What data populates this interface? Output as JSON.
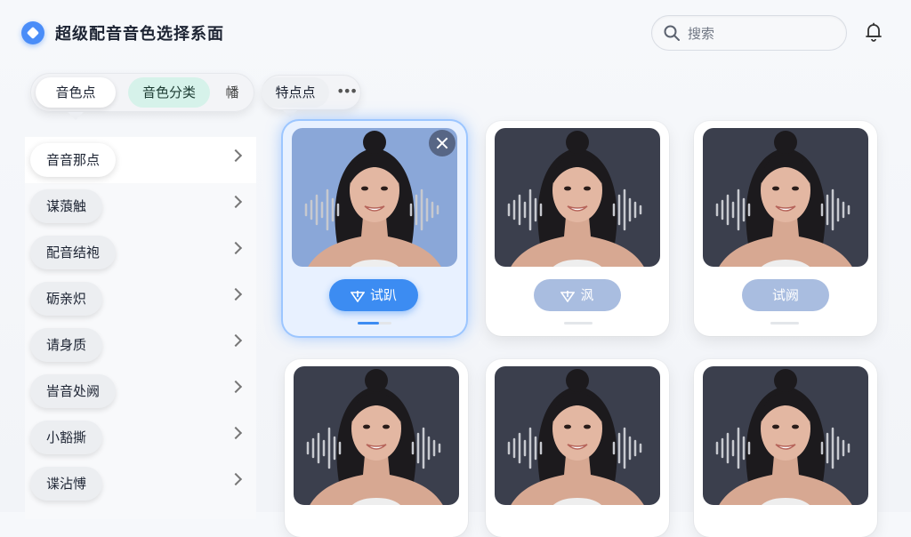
{
  "app": {
    "title": "超级配音音色选择系面",
    "logo_icon": "app-logo-icon"
  },
  "search": {
    "placeholder": "搜索",
    "icon": "search-icon"
  },
  "header": {
    "notification_icon": "bell-icon"
  },
  "filters": {
    "tab1": "音色点",
    "tab2": "音色分类",
    "tab3": "幡",
    "tab4": "特点点",
    "more": "•••"
  },
  "sidebar": {
    "items": [
      {
        "label": "音音那点"
      },
      {
        "label": "谋蒗触"
      },
      {
        "label": "配音结袍"
      },
      {
        "label": "砺亲炽"
      },
      {
        "label": "请身质"
      },
      {
        "label": "峕音处阙"
      },
      {
        "label": "小豁撕"
      },
      {
        "label": "谍沾愽"
      }
    ]
  },
  "cards": [
    {
      "play_label": "试趴",
      "selected": true,
      "progress": 0.55
    },
    {
      "play_label": "沨",
      "selected": false,
      "progress": 0
    },
    {
      "play_label": "试阙",
      "selected": false,
      "progress": 0
    },
    {
      "play_label": "",
      "selected": false,
      "progress": 0
    },
    {
      "play_label": "",
      "selected": false,
      "progress": 0
    },
    {
      "play_label": "",
      "selected": false,
      "progress": 0
    }
  ],
  "colors": {
    "accent": "#3c8cf2",
    "selected_pill": "#d6f2ea"
  }
}
